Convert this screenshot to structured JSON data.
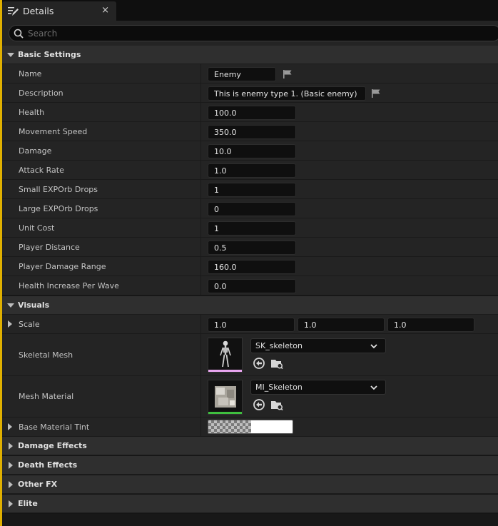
{
  "tab": {
    "title": "Details",
    "close": "×",
    "icon": "pencil-details-icon"
  },
  "search": {
    "placeholder": "Search",
    "icon": "search-icon"
  },
  "basic_settings": {
    "label": "Basic Settings",
    "name": {
      "label": "Name",
      "value": "Enemy"
    },
    "description": {
      "label": "Description",
      "value": "This is enemy type 1. (Basic enemy)"
    },
    "health": {
      "label": "Health",
      "value": "100.0"
    },
    "movement_speed": {
      "label": "Movement Speed",
      "value": "350.0"
    },
    "damage": {
      "label": "Damage",
      "value": "10.0"
    },
    "attack_rate": {
      "label": "Attack Rate",
      "value": "1.0"
    },
    "small_exp": {
      "label": "Small EXPOrb Drops",
      "value": "1"
    },
    "large_exp": {
      "label": "Large EXPOrb Drops",
      "value": "0"
    },
    "unit_cost": {
      "label": "Unit Cost",
      "value": "1"
    },
    "player_distance": {
      "label": "Player Distance",
      "value": "0.5"
    },
    "player_damage_range": {
      "label": "Player Damage Range",
      "value": "160.0"
    },
    "health_increase": {
      "label": "Health Increase Per Wave",
      "value": "0.0"
    }
  },
  "visuals": {
    "label": "Visuals",
    "scale": {
      "label": "Scale",
      "x": "1.0",
      "y": "1.0",
      "z": "1.0"
    },
    "skeletal_mesh": {
      "label": "Skeletal Mesh",
      "asset": "SK_skeleton",
      "bar_color": "#e9a6f0"
    },
    "mesh_material": {
      "label": "Mesh Material",
      "asset": "MI_Skeleton",
      "bar_color": "#3fbf3f"
    },
    "base_material_tint": {
      "label": "Base Material Tint",
      "color": "#ffffff"
    }
  },
  "collapsed_categories": {
    "damage_effects": "Damage Effects",
    "death_effects": "Death Effects",
    "other_fx": "Other FX",
    "elite": "Elite"
  },
  "colors": {
    "accent_edge": "#e0b000",
    "panel": "#242424",
    "category": "#2f2f2f"
  }
}
